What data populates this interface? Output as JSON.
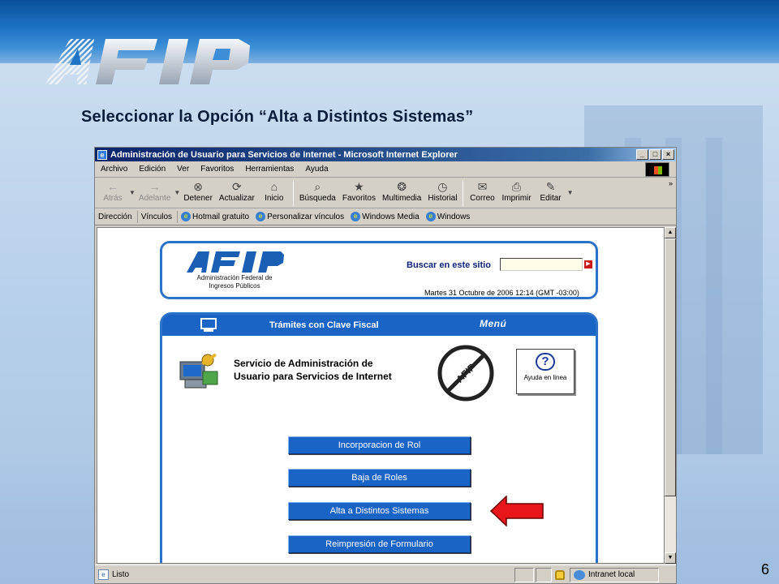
{
  "slide": {
    "title": "Seleccionar la Opción “Alta a Distintos Sistemas”",
    "page_number": "6",
    "logo_text": "AFIP"
  },
  "browser": {
    "title": "Administración de Usuario para Servicios de Internet - Microsoft Internet Explorer",
    "window_buttons": [
      "_",
      "□",
      "×"
    ],
    "menu": [
      "Archivo",
      "Edición",
      "Ver",
      "Favoritos",
      "Herramientas",
      "Ayuda"
    ],
    "toolbar": [
      {
        "label": "Atrás",
        "icon": "back-arrow-icon",
        "glyph": "←",
        "disabled": true
      },
      {
        "label": "Adelante",
        "icon": "forward-arrow-icon",
        "glyph": "→",
        "disabled": true
      },
      {
        "label": "Detener",
        "icon": "stop-icon",
        "glyph": "⊗",
        "disabled": false
      },
      {
        "label": "Actualizar",
        "icon": "refresh-icon",
        "glyph": "⟳",
        "disabled": false
      },
      {
        "label": "Inicio",
        "icon": "home-icon",
        "glyph": "⌂",
        "disabled": false
      },
      {
        "label": "Búsqueda",
        "icon": "search-icon",
        "glyph": "⌕",
        "disabled": false
      },
      {
        "label": "Favoritos",
        "icon": "favorites-icon",
        "glyph": "★",
        "disabled": false
      },
      {
        "label": "Multimedia",
        "icon": "multimedia-icon",
        "glyph": "❂",
        "disabled": false
      },
      {
        "label": "Historial",
        "icon": "history-icon",
        "glyph": "◷",
        "disabled": false
      },
      {
        "label": "Correo",
        "icon": "mail-icon",
        "glyph": "✉",
        "disabled": false
      },
      {
        "label": "Imprimir",
        "icon": "print-icon",
        "glyph": "⎙",
        "disabled": false
      },
      {
        "label": "Editar",
        "icon": "edit-icon",
        "glyph": "✎",
        "disabled": false
      }
    ],
    "address_label": "Dirección",
    "links_label": "Vínculos",
    "links": [
      "Hotmail gratuito",
      "Personalizar vínculos",
      "Windows Media",
      "Windows"
    ],
    "status_text": "Listo",
    "zone": "Intranet local"
  },
  "page": {
    "header": {
      "logo_text": "AFIP",
      "org_line1": "Administración Federal de",
      "org_line2": "Ingresos Públicos",
      "search_label": "Buscar en este sitio",
      "search_value": "",
      "date": "Martes 31 Octubre de 2006 12:14 (GMT -03:00)"
    },
    "panel": {
      "title": "Trámites con Clave Fiscal",
      "menu": "Menú",
      "service_line1": "Servicio de Administración de",
      "service_line2": "Usuario para Servicios de Internet",
      "help_label": "Ayuda en linea",
      "options": [
        "Incorporacion de Rol",
        "Baja de Roles",
        "Alta a Distintos Sistemas",
        "Reimpresión de Formulario"
      ]
    }
  },
  "colors": {
    "accent_blue": "#1a64c6",
    "arrow_red": "#e8151b",
    "title_bar": "#0a246a"
  }
}
